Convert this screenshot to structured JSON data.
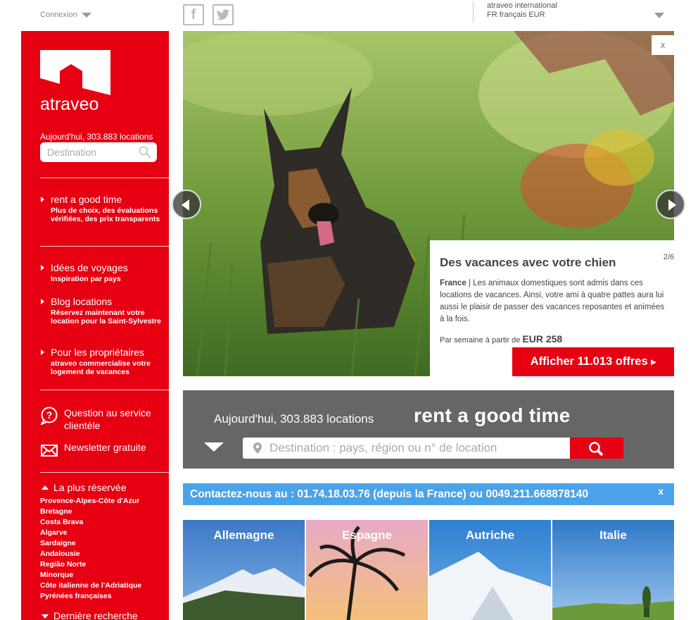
{
  "topbar": {
    "login_label": "Connexion",
    "social": [
      "f",
      "t"
    ],
    "intl_line1": "atraveo international",
    "intl_line2": "FR français EUR"
  },
  "sidebar": {
    "logo_text": "atraveo",
    "count_label": "Aujourd'hui, 303.883 locations",
    "search_placeholder": "Destination",
    "items": [
      {
        "label": "rent a good time",
        "sub": "Plus de choix, des évaluations vérifiées, des prix transparents"
      },
      {
        "label": "Idées de voyages",
        "sub": "Inspiration par pays"
      },
      {
        "label": "Blog locations",
        "sub": "Réservez maintenant votre location pour la Saint-Sylvestre"
      },
      {
        "label": "Pour les propriétaires",
        "sub": "atraveo commercialise votre logement de vacances"
      }
    ],
    "links": [
      {
        "label": "Question au service clientèle",
        "icon": "question-icon"
      },
      {
        "label": "Newsletter gratuite",
        "icon": "envelope-icon"
      }
    ],
    "popular_title": "La plus réservée",
    "popular": [
      "Provence-Alpes-Côte d'Azur",
      "Bretagne",
      "Costa Brava",
      "Algarve",
      "Sardaigne",
      "Andalousie",
      "Região Norte",
      "Minorque",
      "Côte italienne de l'Adriatique",
      "Pyrénées françaises"
    ],
    "last_search": "Dernière recherche"
  },
  "hero": {
    "close": "x",
    "title": "Des vacances avec votre chien",
    "pager": "2/6",
    "desc_strong": "France",
    "desc": " | Les animaux domestiques sont admis dans ces locations de vacances. Ainsi, votre ami à quatre pattes aura lui aussi le plaisir de passer des vacances reposantes et animées à la fois.",
    "price_prefix": "Par semaine à partir de ",
    "price_value": "EUR 258",
    "cta": "Afficher 11.013 offres"
  },
  "search": {
    "count_label": "Aujourd'hui, 303.883 locations",
    "slogan": "rent a good time",
    "placeholder": "Destination : pays, région ou n° de location"
  },
  "contact": {
    "text": "Contactez-nous au : 01.74.18.03.76 (depuis la France) ou 0049.211.668878140",
    "close": "x"
  },
  "destinations": [
    "Allemagne",
    "Espagne",
    "Autriche",
    "Italie"
  ],
  "colors": {
    "brand_red": "#e60012",
    "contact_blue": "#4aa3ea",
    "search_gray": "#666666"
  }
}
